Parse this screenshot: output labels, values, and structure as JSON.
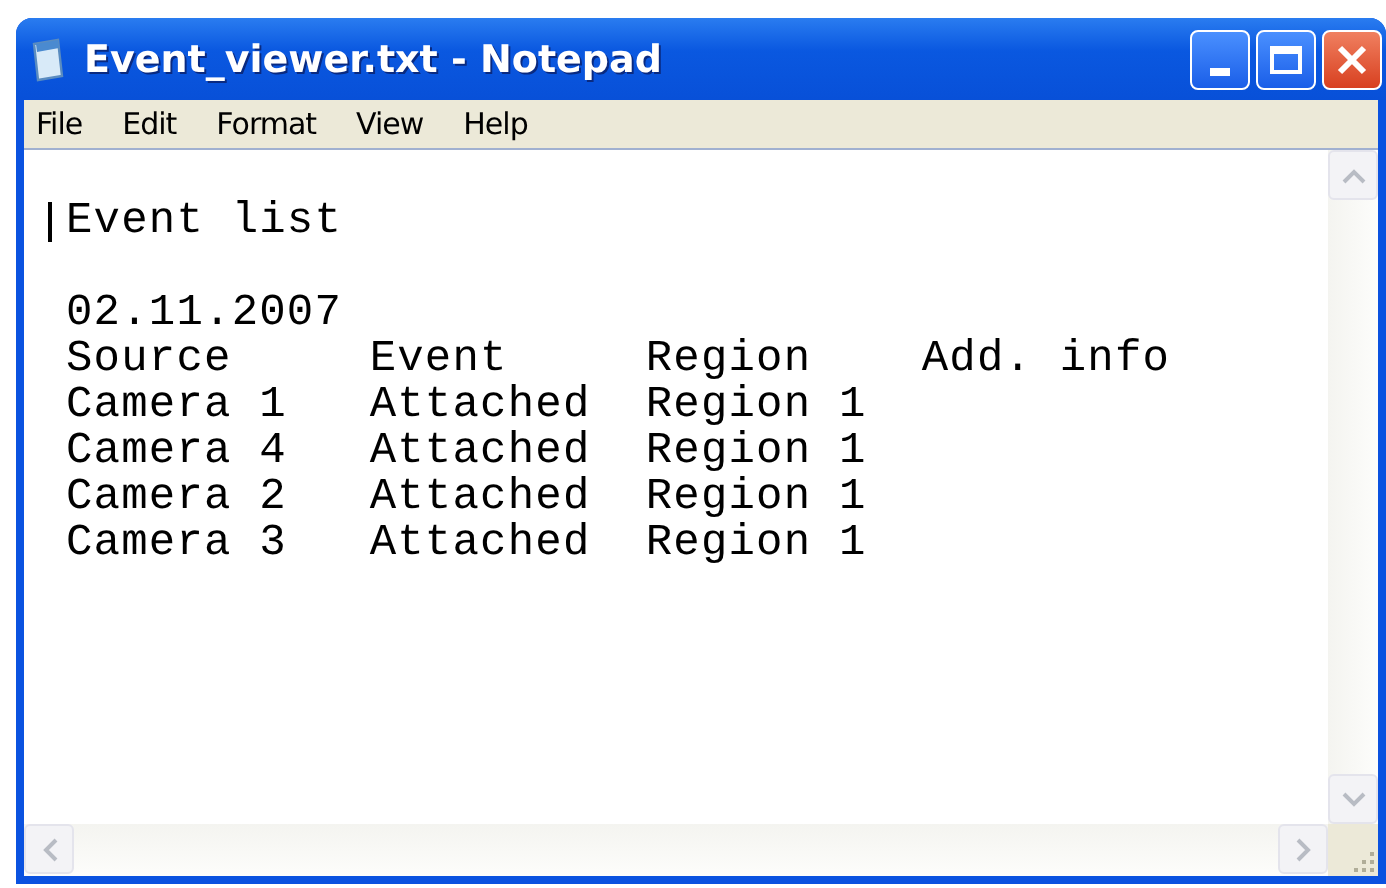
{
  "window": {
    "title": "Event_viewer.txt - Notepad"
  },
  "menu": [
    {
      "label": "File"
    },
    {
      "label": "Edit"
    },
    {
      "label": "Format"
    },
    {
      "label": "View"
    },
    {
      "label": "Help"
    }
  ],
  "editor": {
    "heading": "Event list",
    "lines": [
      "02.11.2007",
      "Source     Event     Region    Add. info",
      "Camera 1   Attached  Region 1",
      "Camera 4   Attached  Region 1",
      "Camera 2   Attached  Region 1",
      "Camera 3   Attached  Region 1"
    ]
  }
}
